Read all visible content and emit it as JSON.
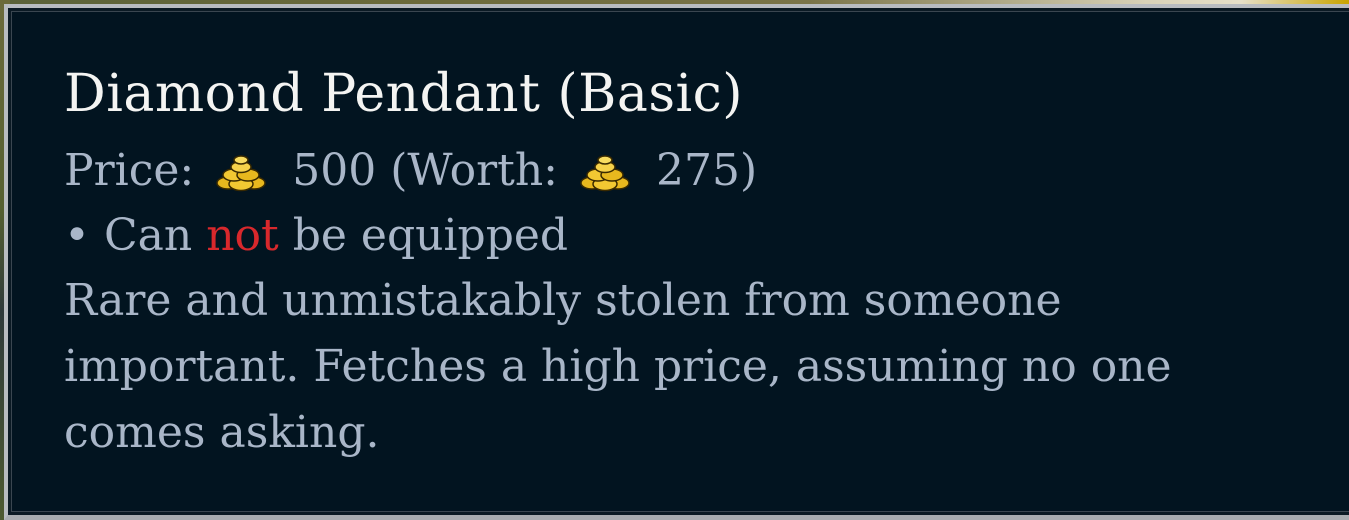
{
  "tooltip": {
    "title": "Diamond Pendant (Basic)",
    "price_label": "Price:",
    "price_value": "500",
    "worth_open": "(Worth:",
    "worth_value": "275)",
    "currency_icon": "gold-coins-icon",
    "equip_bullet": "•",
    "equip_prefix": "Can",
    "equip_negation": "not",
    "equip_suffix": "be equipped",
    "description": "Rare and unmistakably stolen from someone important. Fetches a high price, assuming no one comes asking.",
    "colors": {
      "background": "#021420",
      "title": "#f4f4f2",
      "body_text": "#a9b6c8",
      "negation": "#d8282c",
      "border": "#b8bcc0",
      "gold": "#e8b81e"
    }
  }
}
